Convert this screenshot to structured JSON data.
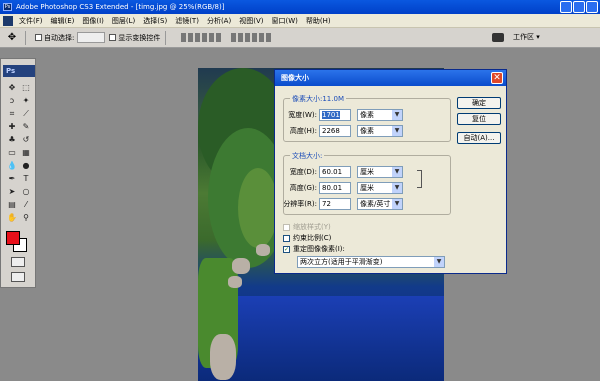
{
  "window": {
    "title": "Adobe Photoshop CS3 Extended - [timg.jpg @ 25%(RGB/8)]"
  },
  "menu": [
    "文件(F)",
    "编辑(E)",
    "图像(I)",
    "图层(L)",
    "选择(S)",
    "滤镜(T)",
    "分析(A)",
    "视图(V)",
    "窗口(W)",
    "帮助(H)"
  ],
  "options": {
    "auto_select_label": "自动选择:",
    "show_transform_label": "显示变换控件",
    "workspace_label": "工作区 ▾"
  },
  "toolbox": {
    "badge": "Ps"
  },
  "dialog": {
    "title": "图像大小",
    "pixel_group": {
      "title": "像素大小:11.0M",
      "width_label": "宽度(W):",
      "width_value": "1701",
      "width_unit": "像素",
      "height_label": "高度(H):",
      "height_value": "2268",
      "height_unit": "像素"
    },
    "doc_group": {
      "title": "文档大小:",
      "width_label": "宽度(D):",
      "width_value": "60.01",
      "width_unit": "厘米",
      "height_label": "高度(G):",
      "height_value": "80.01",
      "height_unit": "厘米",
      "res_label": "分辨率(R):",
      "res_value": "72",
      "res_unit": "像素/英寸"
    },
    "scale_styles_label": "缩放样式(Y)",
    "constrain_label": "约束比例(C)",
    "resample_label": "重定图像像素(I):",
    "resample_method": "两次立方(适用于平滑渐变)",
    "ok_label": "确定",
    "reset_label": "复位",
    "auto_label": "自动(A)..."
  }
}
